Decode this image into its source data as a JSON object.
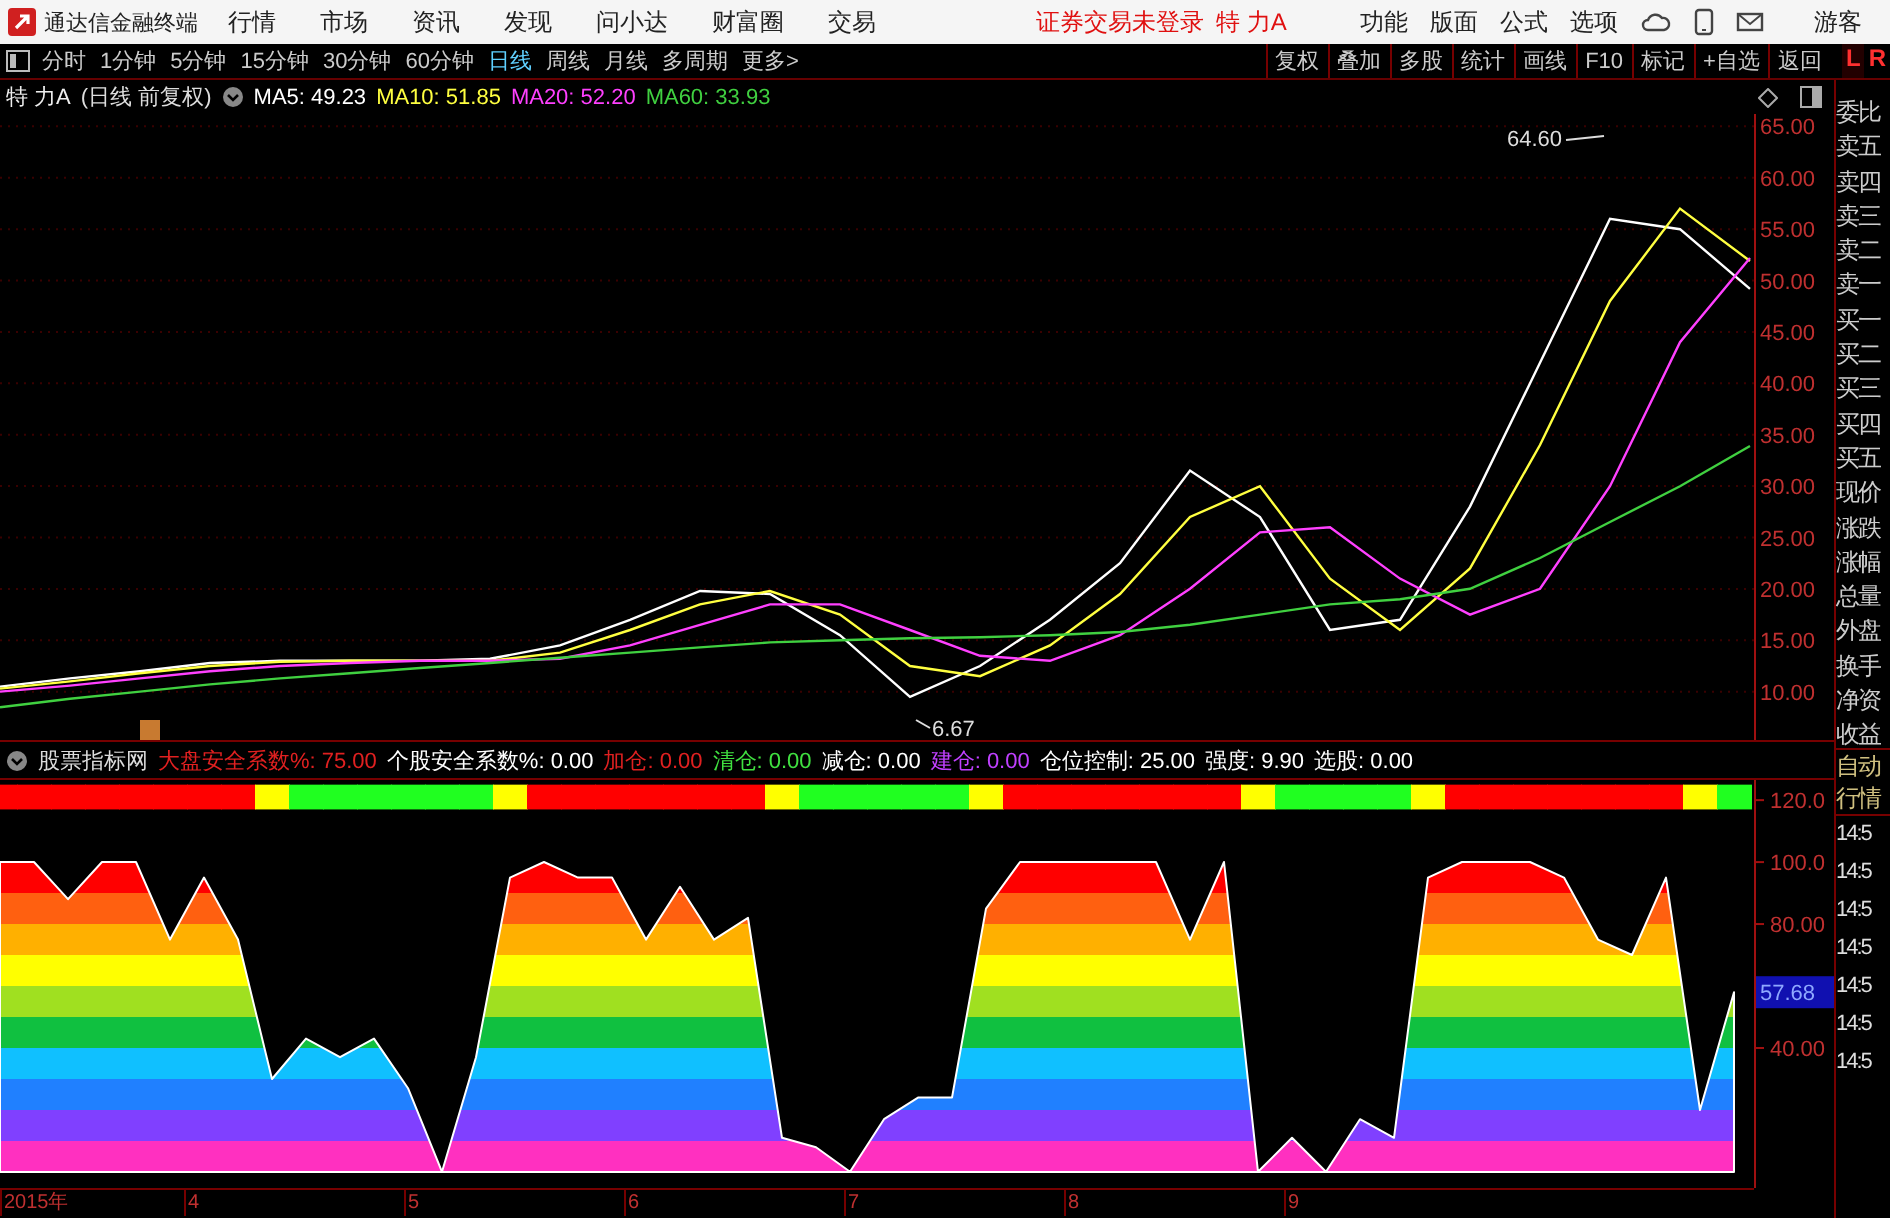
{
  "title_bar": {
    "app_title": "通达信金融终端",
    "menu": [
      "行情",
      "市场",
      "资讯",
      "发现",
      "问小达",
      "财富圈",
      "交易"
    ],
    "login_notice": "证券交易未登录",
    "stock": "特 力A",
    "tools": [
      "功能",
      "版面",
      "公式",
      "选项"
    ],
    "user": "游客"
  },
  "toolbar": {
    "periods": [
      {
        "label": "分时",
        "selected": false
      },
      {
        "label": "1分钟",
        "selected": false
      },
      {
        "label": "5分钟",
        "selected": false
      },
      {
        "label": "15分钟",
        "selected": false
      },
      {
        "label": "30分钟",
        "selected": false
      },
      {
        "label": "60分钟",
        "selected": false
      },
      {
        "label": "日线",
        "selected": true
      },
      {
        "label": "周线",
        "selected": false
      },
      {
        "label": "月线",
        "selected": false
      },
      {
        "label": "多周期",
        "selected": false
      },
      {
        "label": "更多>",
        "selected": false
      }
    ],
    "buttons": [
      "复权",
      "叠加",
      "多股",
      "统计",
      "画线",
      "F10",
      "标记",
      "+自选",
      "返回"
    ],
    "corner_left": "L",
    "corner_right": "R"
  },
  "legend": {
    "stock": "特 力A",
    "mode": "(日线 前复权)",
    "values": [
      "49.23",
      "51.85",
      "52.20",
      "33.93"
    ]
  },
  "main_chart": {
    "chart_data": {
      "type": "line",
      "categories": [
        null,
        null,
        null,
        null,
        null,
        null,
        null,
        null,
        null,
        null,
        null,
        null,
        null,
        null,
        null,
        null,
        null,
        null,
        null,
        null,
        null,
        null,
        null,
        null,
        null,
        null
      ],
      "ylim": [
        5.3,
        66.2
      ],
      "grid": true,
      "yticks": [
        {
          "value": 65,
          "label": "65.00"
        },
        {
          "value": 60,
          "label": "60.00"
        },
        {
          "value": 55,
          "label": "55.00"
        },
        {
          "value": 50,
          "label": "50.00"
        },
        {
          "value": 45,
          "label": "45.00"
        },
        {
          "value": 40,
          "label": "40.00"
        },
        {
          "value": 35,
          "label": "35.00"
        },
        {
          "value": 30,
          "label": "30.00"
        },
        {
          "value": 25,
          "label": "25.00"
        },
        {
          "value": 20,
          "label": "20.00"
        },
        {
          "value": 15,
          "label": "15.00"
        },
        {
          "value": 10,
          "label": "10.00"
        }
      ],
      "series": [
        {
          "name": "MA5:",
          "color": "#ffffff",
          "values": [
            10.5,
            11.3,
            12,
            12.8,
            13,
            13,
            13,
            13.2,
            14.5,
            17,
            19.8,
            19.5,
            15.5,
            9.5,
            12.5,
            17,
            22.5,
            31.5,
            27,
            16,
            17,
            28,
            42,
            56,
            55,
            49.2
          ]
        },
        {
          "name": "MA10:",
          "color": "#ffff40",
          "values": [
            10.3,
            11,
            11.8,
            12.5,
            12.9,
            13,
            13,
            13,
            13.8,
            16,
            18.5,
            19.8,
            17.5,
            12.5,
            11.5,
            14.5,
            19.5,
            27,
            30,
            21,
            16,
            22,
            34,
            48,
            57,
            51.9
          ]
        },
        {
          "name": "MA20:",
          "color": "#ff40ff",
          "values": [
            10,
            10.6,
            11.3,
            12,
            12.5,
            12.8,
            13,
            13,
            13.2,
            14.5,
            16.5,
            18.5,
            18.5,
            16,
            13.5,
            13,
            15.5,
            20,
            25.5,
            26,
            21,
            17.5,
            20,
            30,
            44,
            52.2
          ]
        },
        {
          "name": "MA60:",
          "color": "#40d040",
          "values": [
            8.5,
            9.3,
            10,
            10.7,
            11.3,
            11.8,
            12.3,
            12.8,
            13.3,
            13.8,
            14.3,
            14.8,
            15,
            15.2,
            15.3,
            15.5,
            15.8,
            16.5,
            17.5,
            18.5,
            19,
            20,
            23,
            26.5,
            30,
            33.9
          ]
        }
      ],
      "annotations": [
        "64.60",
        "6.67"
      ]
    }
  },
  "indicator": {
    "name": "股票指标网",
    "items": [
      {
        "label": "大盘安全系数%:",
        "value": "75.00",
        "color": "#e02020"
      },
      {
        "label": "个股安全系数%:",
        "value": "0.00",
        "color": "#ffffff"
      },
      {
        "label": "加仓:",
        "value": "0.00",
        "color": "#e02020"
      },
      {
        "label": "清仓:",
        "value": "0.00",
        "color": "#40e040"
      },
      {
        "label": "减仓:",
        "value": "0.00",
        "color": "#ffffff"
      },
      {
        "label": "建仓:",
        "value": "0.00",
        "color": "#c040ff"
      },
      {
        "label": "仓位控制:",
        "value": "25.00",
        "color": "#ffffff"
      },
      {
        "label": "强度:",
        "value": "9.90",
        "color": "#ffffff"
      },
      {
        "label": "选股:",
        "value": "0.00",
        "color": "#ffffff"
      }
    ],
    "chart_data": {
      "type": "area",
      "categories": [
        null,
        null,
        null,
        null,
        null,
        null,
        null,
        null,
        null,
        null,
        null,
        null,
        null,
        null,
        null,
        null,
        null,
        null,
        null,
        null,
        null,
        null,
        null,
        null,
        null,
        null,
        null,
        null,
        null,
        null,
        null,
        null,
        null,
        null,
        null,
        null,
        null,
        null,
        null,
        null,
        null,
        null,
        null,
        null,
        null,
        null,
        null,
        null,
        null,
        null,
        null,
        null
      ],
      "ylim": [
        -5.2,
        126.5
      ],
      "yticks": [
        {
          "value": 120,
          "label": "120.0"
        },
        {
          "value": 100,
          "label": "100.0"
        },
        {
          "value": 80,
          "label": "80.00"
        },
        {
          "value": 40,
          "label": "40.00"
        }
      ],
      "series": [
        {
          "color": "#ffffff",
          "values": [
            100,
            100,
            88,
            100,
            100,
            75,
            95,
            75,
            30,
            43,
            37,
            43,
            27,
            0,
            37,
            95,
            100,
            95,
            95,
            75,
            92,
            75,
            82,
            11,
            8,
            0,
            17,
            24,
            24,
            85,
            100,
            100,
            100,
            100,
            100,
            75,
            100,
            0,
            11,
            0,
            17,
            11,
            95,
            100,
            100,
            100,
            95,
            75,
            70,
            95,
            20,
            58
          ]
        }
      ]
    },
    "current_label": "57.68",
    "date_labels": [
      "2015年",
      "4",
      "5",
      "6",
      "7",
      "8",
      "9"
    ]
  },
  "quote_labels": [
    "委比",
    "卖五",
    "卖四",
    "卖三",
    "卖二",
    "卖一",
    "买一",
    "买二",
    "买三",
    "买四",
    "买五",
    "现价",
    "涨跌",
    "涨幅",
    "总量",
    "外盘",
    "换手",
    "净资",
    "收益"
  ],
  "side_lower": {
    "button": "自动行情",
    "times": [
      "14:5",
      "14:5",
      "14:5",
      "14:5",
      "14:5",
      "14:5",
      "14:5"
    ]
  }
}
